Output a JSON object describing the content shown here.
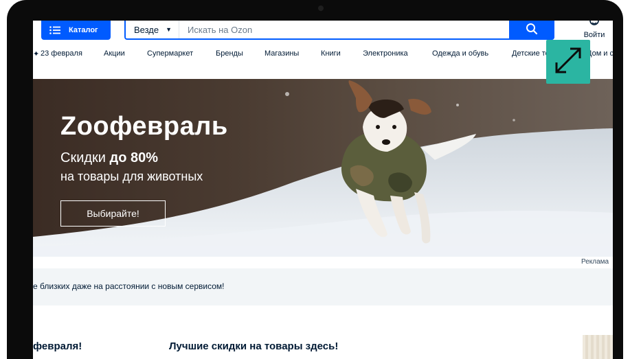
{
  "header": {
    "catalog_label": "Каталог",
    "search_scope": "Везде",
    "search_placeholder": "Искать на Ozon",
    "login_label": "Войти"
  },
  "nav": {
    "items": [
      "23 февраля",
      "Акции",
      "Супермаркет",
      "Бренды",
      "Магазины",
      "Книги",
      "Электроника",
      "Одежда и обувь",
      "Детские товары",
      "Дом и сад"
    ]
  },
  "banner": {
    "title": "Zooфевраль",
    "subtitle_prefix": "Скидки ",
    "subtitle_bold": "до 80%",
    "subtitle_line2": "на товары для животных",
    "cta_label": "Выбирайте!",
    "ad_label": "Реклама"
  },
  "info": {
    "text": "е близких даже на расстоянии с новым сервисом!"
  },
  "sections": {
    "left_title": "февраля!",
    "right_title": "Лучшие скидки на товары здесь!"
  },
  "colors": {
    "brand": "#005bff",
    "expand_button": "#2bb5a2",
    "info_background": "#f2f5f7"
  },
  "icons": {
    "catalog": "menu-lines-icon",
    "search": "magnifier-icon",
    "login": "smiley-icon",
    "expand": "diagonal-expand-arrows-icon"
  }
}
